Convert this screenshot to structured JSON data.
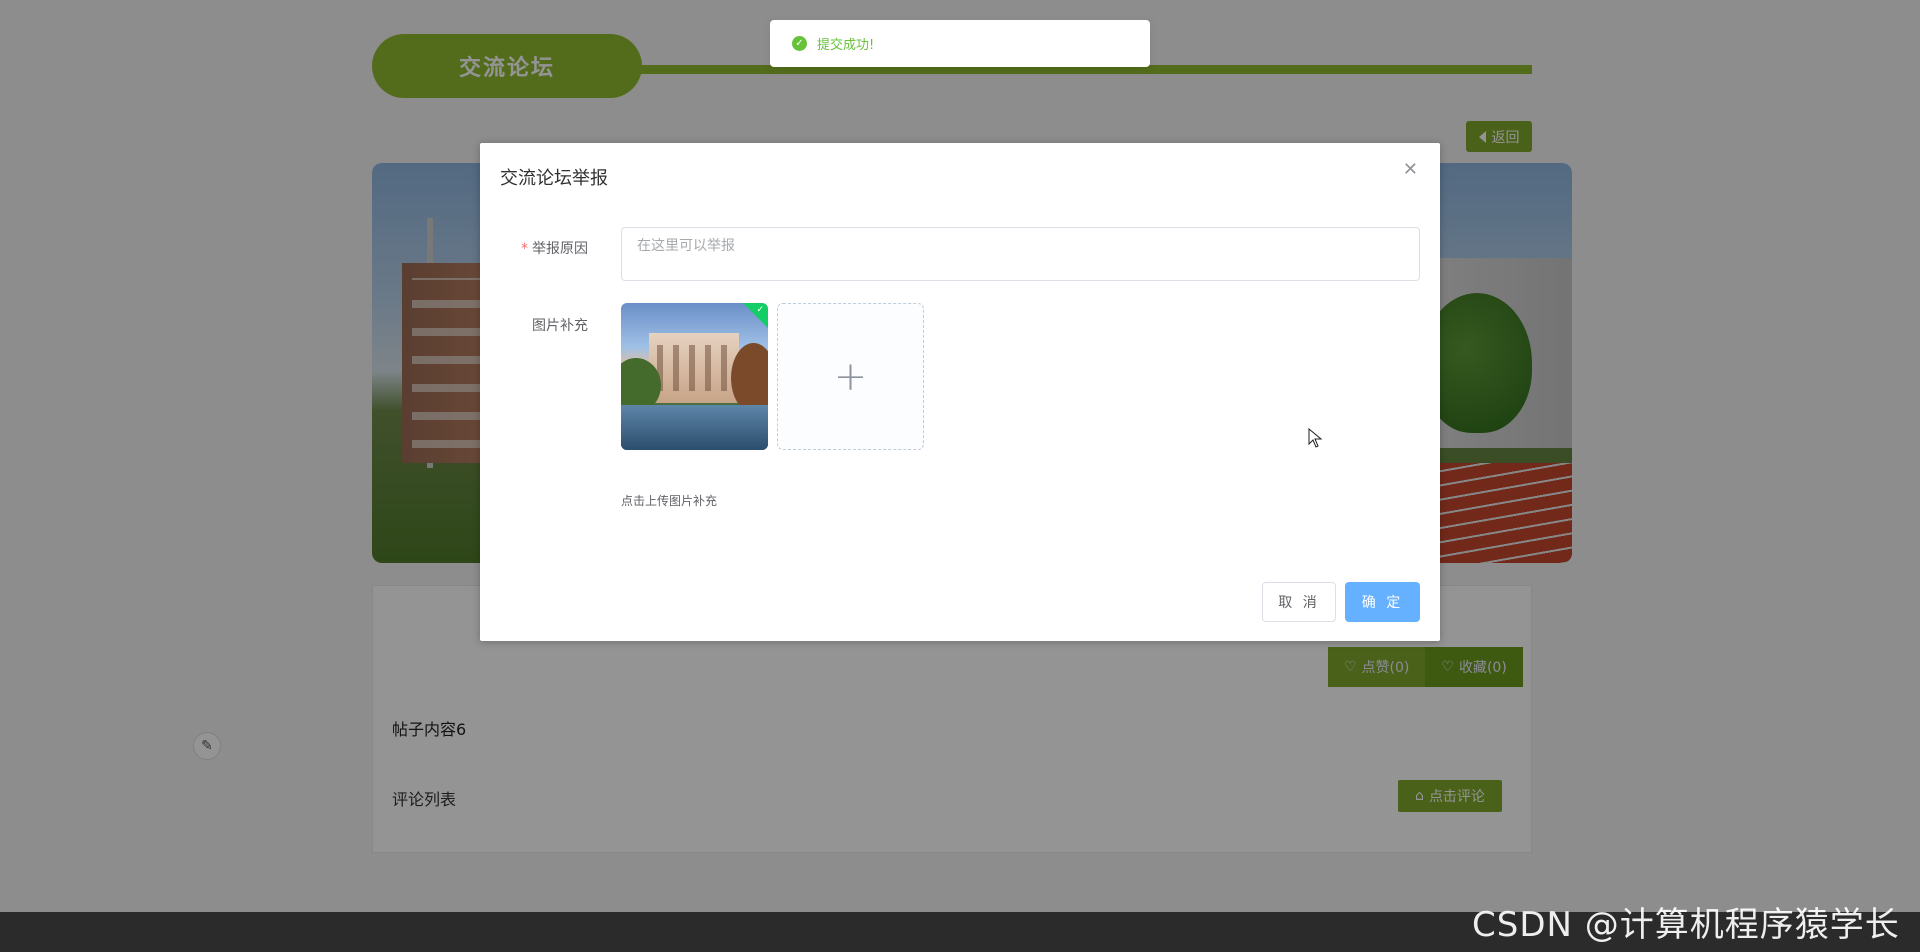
{
  "page": {
    "section_title": "交流论坛",
    "back_label": "返回",
    "like_label": "点赞(0)",
    "favorite_label": "收藏(0)",
    "post_content": "帖子内容6",
    "comments_label": "评论列表",
    "comment_button_label": "点击评论"
  },
  "toast": {
    "message": "提交成功!",
    "icon": "check-circle-icon",
    "color": "#67c23a"
  },
  "dialog": {
    "title": "交流论坛举报",
    "reason_label": "举报原因",
    "reason_placeholder": "在这里可以举报",
    "images_label": "图片补充",
    "upload_tip": "点击上传图片补充",
    "cancel_label": "取 消",
    "confirm_label": "确 定"
  },
  "colors": {
    "brand_green": "#8fba2f",
    "primary_blue": "#66b1ff",
    "success_green": "#13ce66",
    "required_red": "#f56c6c"
  },
  "watermark": "CSDN @计算机程序猿学长"
}
